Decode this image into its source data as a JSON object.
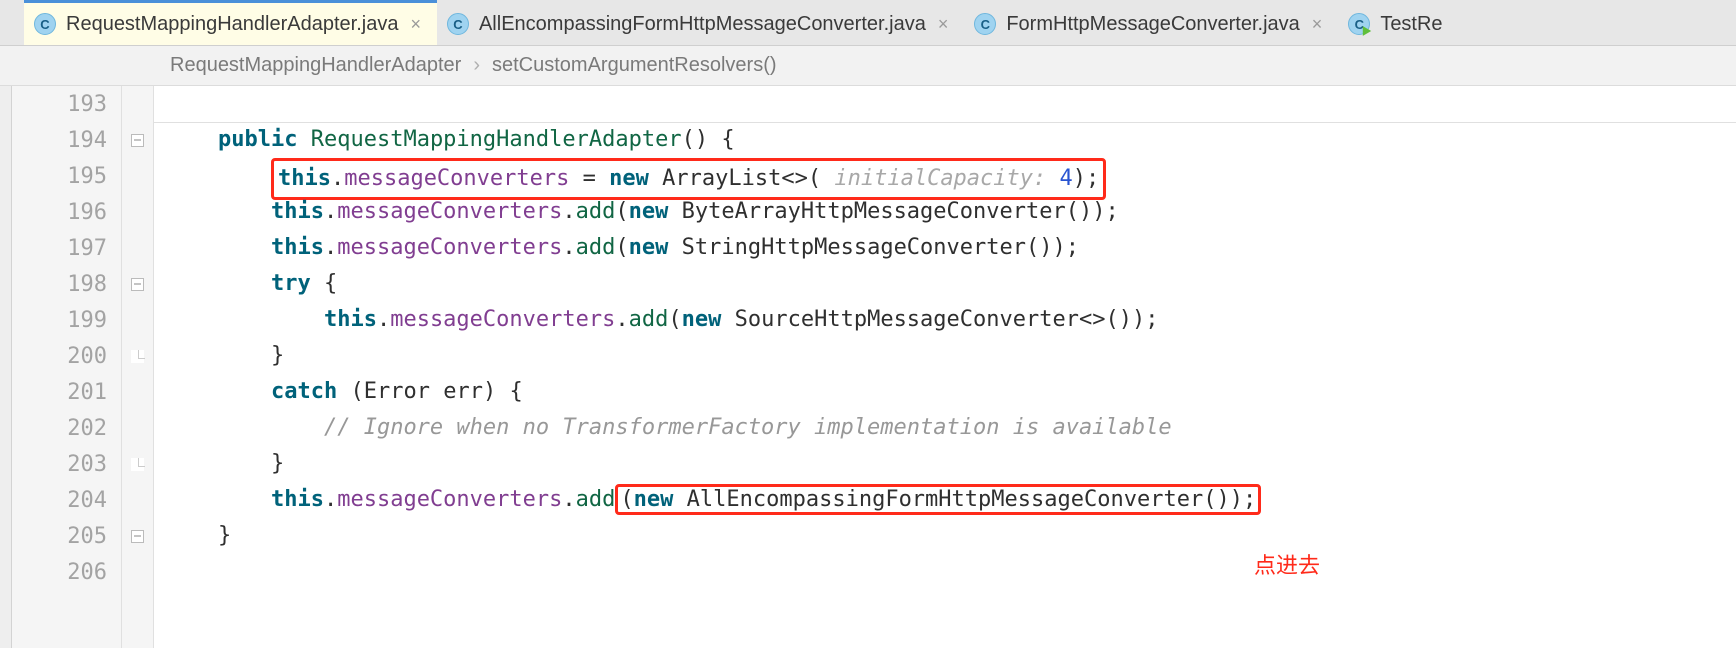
{
  "tabs": [
    {
      "label": "RequestMappingHandlerAdapter.java",
      "active": true,
      "iconLetter": "C",
      "runnable": false
    },
    {
      "label": "AllEncompassingFormHttpMessageConverter.java",
      "active": false,
      "iconLetter": "C",
      "runnable": false
    },
    {
      "label": "FormHttpMessageConverter.java",
      "active": false,
      "iconLetter": "C",
      "runnable": false
    },
    {
      "label": "TestRe",
      "active": false,
      "iconLetter": "C",
      "runnable": true
    }
  ],
  "tab_close_glyph": "×",
  "breadcrumb": {
    "class": "RequestMappingHandlerAdapter",
    "sep": "›",
    "method": "setCustomArgumentResolvers()"
  },
  "line_numbers": [
    "193",
    "194",
    "195",
    "196",
    "197",
    "198",
    "199",
    "200",
    "201",
    "202",
    "203",
    "204",
    "205",
    "206"
  ],
  "fold_markers": {
    "194": "minus",
    "198": "minus",
    "200": "end",
    "203": "end",
    "205": "minus"
  },
  "code": {
    "l193": "",
    "l194": {
      "kw_public": "public",
      "cls": "RequestMappingHandlerAdapter",
      "open": "() {"
    },
    "l195": {
      "this": "this",
      "dot": ".",
      "field": "messageConverters",
      "eq": " = ",
      "new": "new",
      "cls": "ArrayList",
      "gen": "<>(",
      "hint": " initialCapacity: ",
      "num": "4",
      "close": ");"
    },
    "l196": {
      "this": "this",
      "dot": ".",
      "field": "messageConverters",
      "dot2": ".",
      "mth": "add",
      "open": "(",
      "new": "new",
      "cls": "ByteArrayHttpMessageConverter",
      "close": "());"
    },
    "l197": {
      "this": "this",
      "dot": ".",
      "field": "messageConverters",
      "dot2": ".",
      "mth": "add",
      "open": "(",
      "new": "new",
      "cls": "StringHttpMessageConverter",
      "close": "());"
    },
    "l198": {
      "kw": "try",
      "brace": " {"
    },
    "l199": {
      "this": "this",
      "dot": ".",
      "field": "messageConverters",
      "dot2": ".",
      "mth": "add",
      "open": "(",
      "new": "new",
      "cls": "SourceHttpMessageConverter",
      "gen": "<>",
      "close": "());"
    },
    "l200": {
      "brace": "}"
    },
    "l201": {
      "kw": "catch",
      "open": " (",
      "type": "Error",
      "sp": " ",
      "var": "err",
      "close": ") {"
    },
    "l202": {
      "cmt": "// Ignore when no TransformerFactory implementation is available"
    },
    "l203": {
      "brace": "}"
    },
    "l204": {
      "this": "this",
      "dot": ".",
      "field": "messageConverters",
      "dot2": ".",
      "mth": "add",
      "open": "(",
      "new": "new",
      "cls": "AllEncompassingFormHttpMessageConverter",
      "close": "());"
    },
    "l205": {
      "brace": "}"
    },
    "l206": ""
  },
  "annotation": "点进去"
}
